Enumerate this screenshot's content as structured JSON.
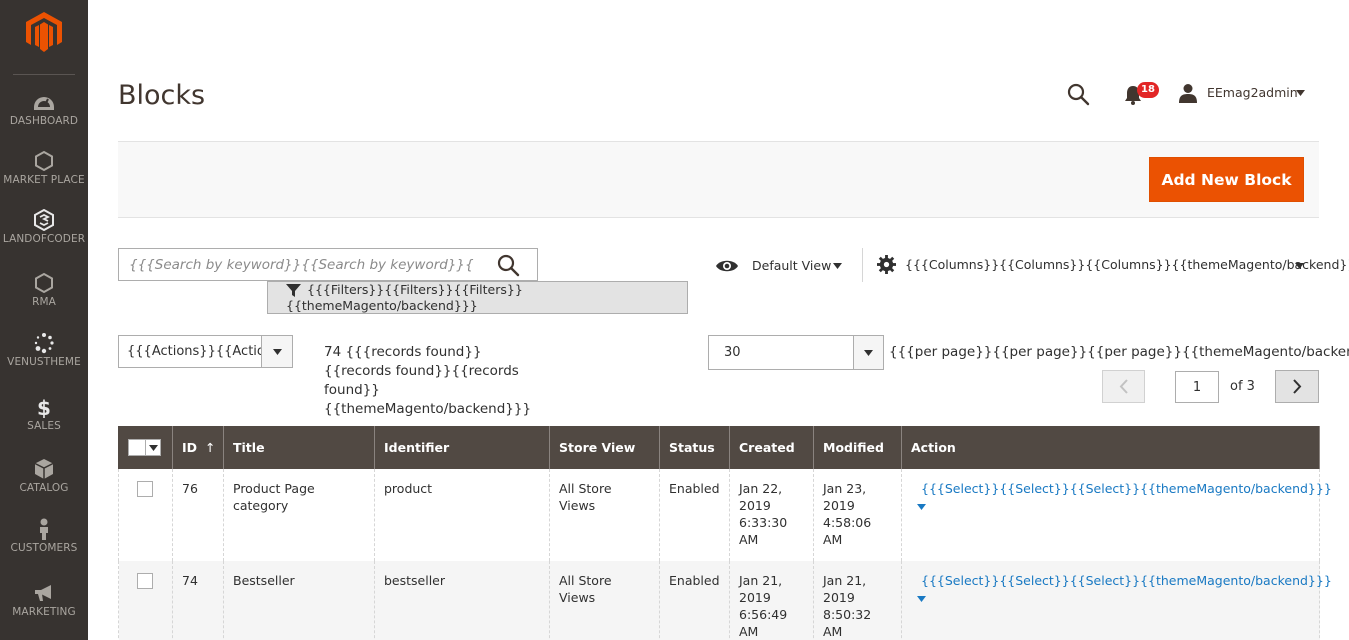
{
  "sidebar": {
    "items": [
      {
        "label": "DASHBOARD",
        "icon": "dashboard-icon"
      },
      {
        "label": "MARKET PLACE",
        "icon": "hexagon-icon"
      },
      {
        "label": "LANDOFCODER",
        "icon": "landofcoder-icon"
      },
      {
        "label": "RMA",
        "icon": "hexagon-icon"
      },
      {
        "label": "VENUSTHEME",
        "icon": "spinner-icon"
      },
      {
        "label": "SALES",
        "icon": "dollar-icon"
      },
      {
        "label": "CATALOG",
        "icon": "cube-icon"
      },
      {
        "label": "CUSTOMERS",
        "icon": "person-icon"
      },
      {
        "label": "MARKETING",
        "icon": "megaphone-icon"
      }
    ]
  },
  "header": {
    "title": "Blocks",
    "notification_count": "18",
    "user_name": "EEmag2admin"
  },
  "toolbar": {
    "add_label": "Add New Block"
  },
  "search": {
    "placeholder": "{{{Search by keyword}}{{Search by keyword}}{{Search by keyword}}{{themeMagento/backend}}}"
  },
  "filters": {
    "label": "{{{Filters}}{{Filters}}{{Filters}}{{themeMagento/backend}}}"
  },
  "view": {
    "label": "Default View"
  },
  "columns": {
    "label": "{{{Columns}}{{Columns}}{{Columns}}{{themeMagento/backend}}}"
  },
  "actions": {
    "label": "{{{Actions}}{{Actions}}{{Actions}}{{themeMagento/backend}}}"
  },
  "records": {
    "text": "74 {{{records found}}{{records found}}{{records found}}{{themeMagento/backend}}}"
  },
  "pagination": {
    "per_page_value": "30",
    "per_page_label": "{{{per page}}{{per page}}{{per page}}{{themeMagento/backend}}}",
    "current_page": "1",
    "of_total": "of 3"
  },
  "grid": {
    "columns": [
      "ID",
      "Title",
      "Identifier",
      "Store View",
      "Status",
      "Created",
      "Modified",
      "Action"
    ],
    "rows": [
      {
        "id": "76",
        "title": "Product Page category",
        "identifier": "product",
        "store_view": "All Store Views",
        "status": "Enabled",
        "created": "Jan 22, 2019 6:33:30 AM",
        "modified": "Jan 23, 2019 4:58:06 AM",
        "action": "{{{Select}}{{Select}}{{Select}}{{themeMagento/backend}}}"
      },
      {
        "id": "74",
        "title": "Bestseller",
        "identifier": "bestseller",
        "store_view": "All Store Views",
        "status": "Enabled",
        "created": "Jan 21, 2019 6:56:49 AM",
        "modified": "Jan 21, 2019 8:50:32 AM",
        "action": "{{{Select}}{{Select}}{{Select}}{{themeMagento/backend}}}"
      }
    ]
  },
  "colors": {
    "sidebar_bg": "#373330",
    "accent": "#eb5202",
    "grid_header": "#514943",
    "link": "#1979c3",
    "badge": "#e22626"
  }
}
